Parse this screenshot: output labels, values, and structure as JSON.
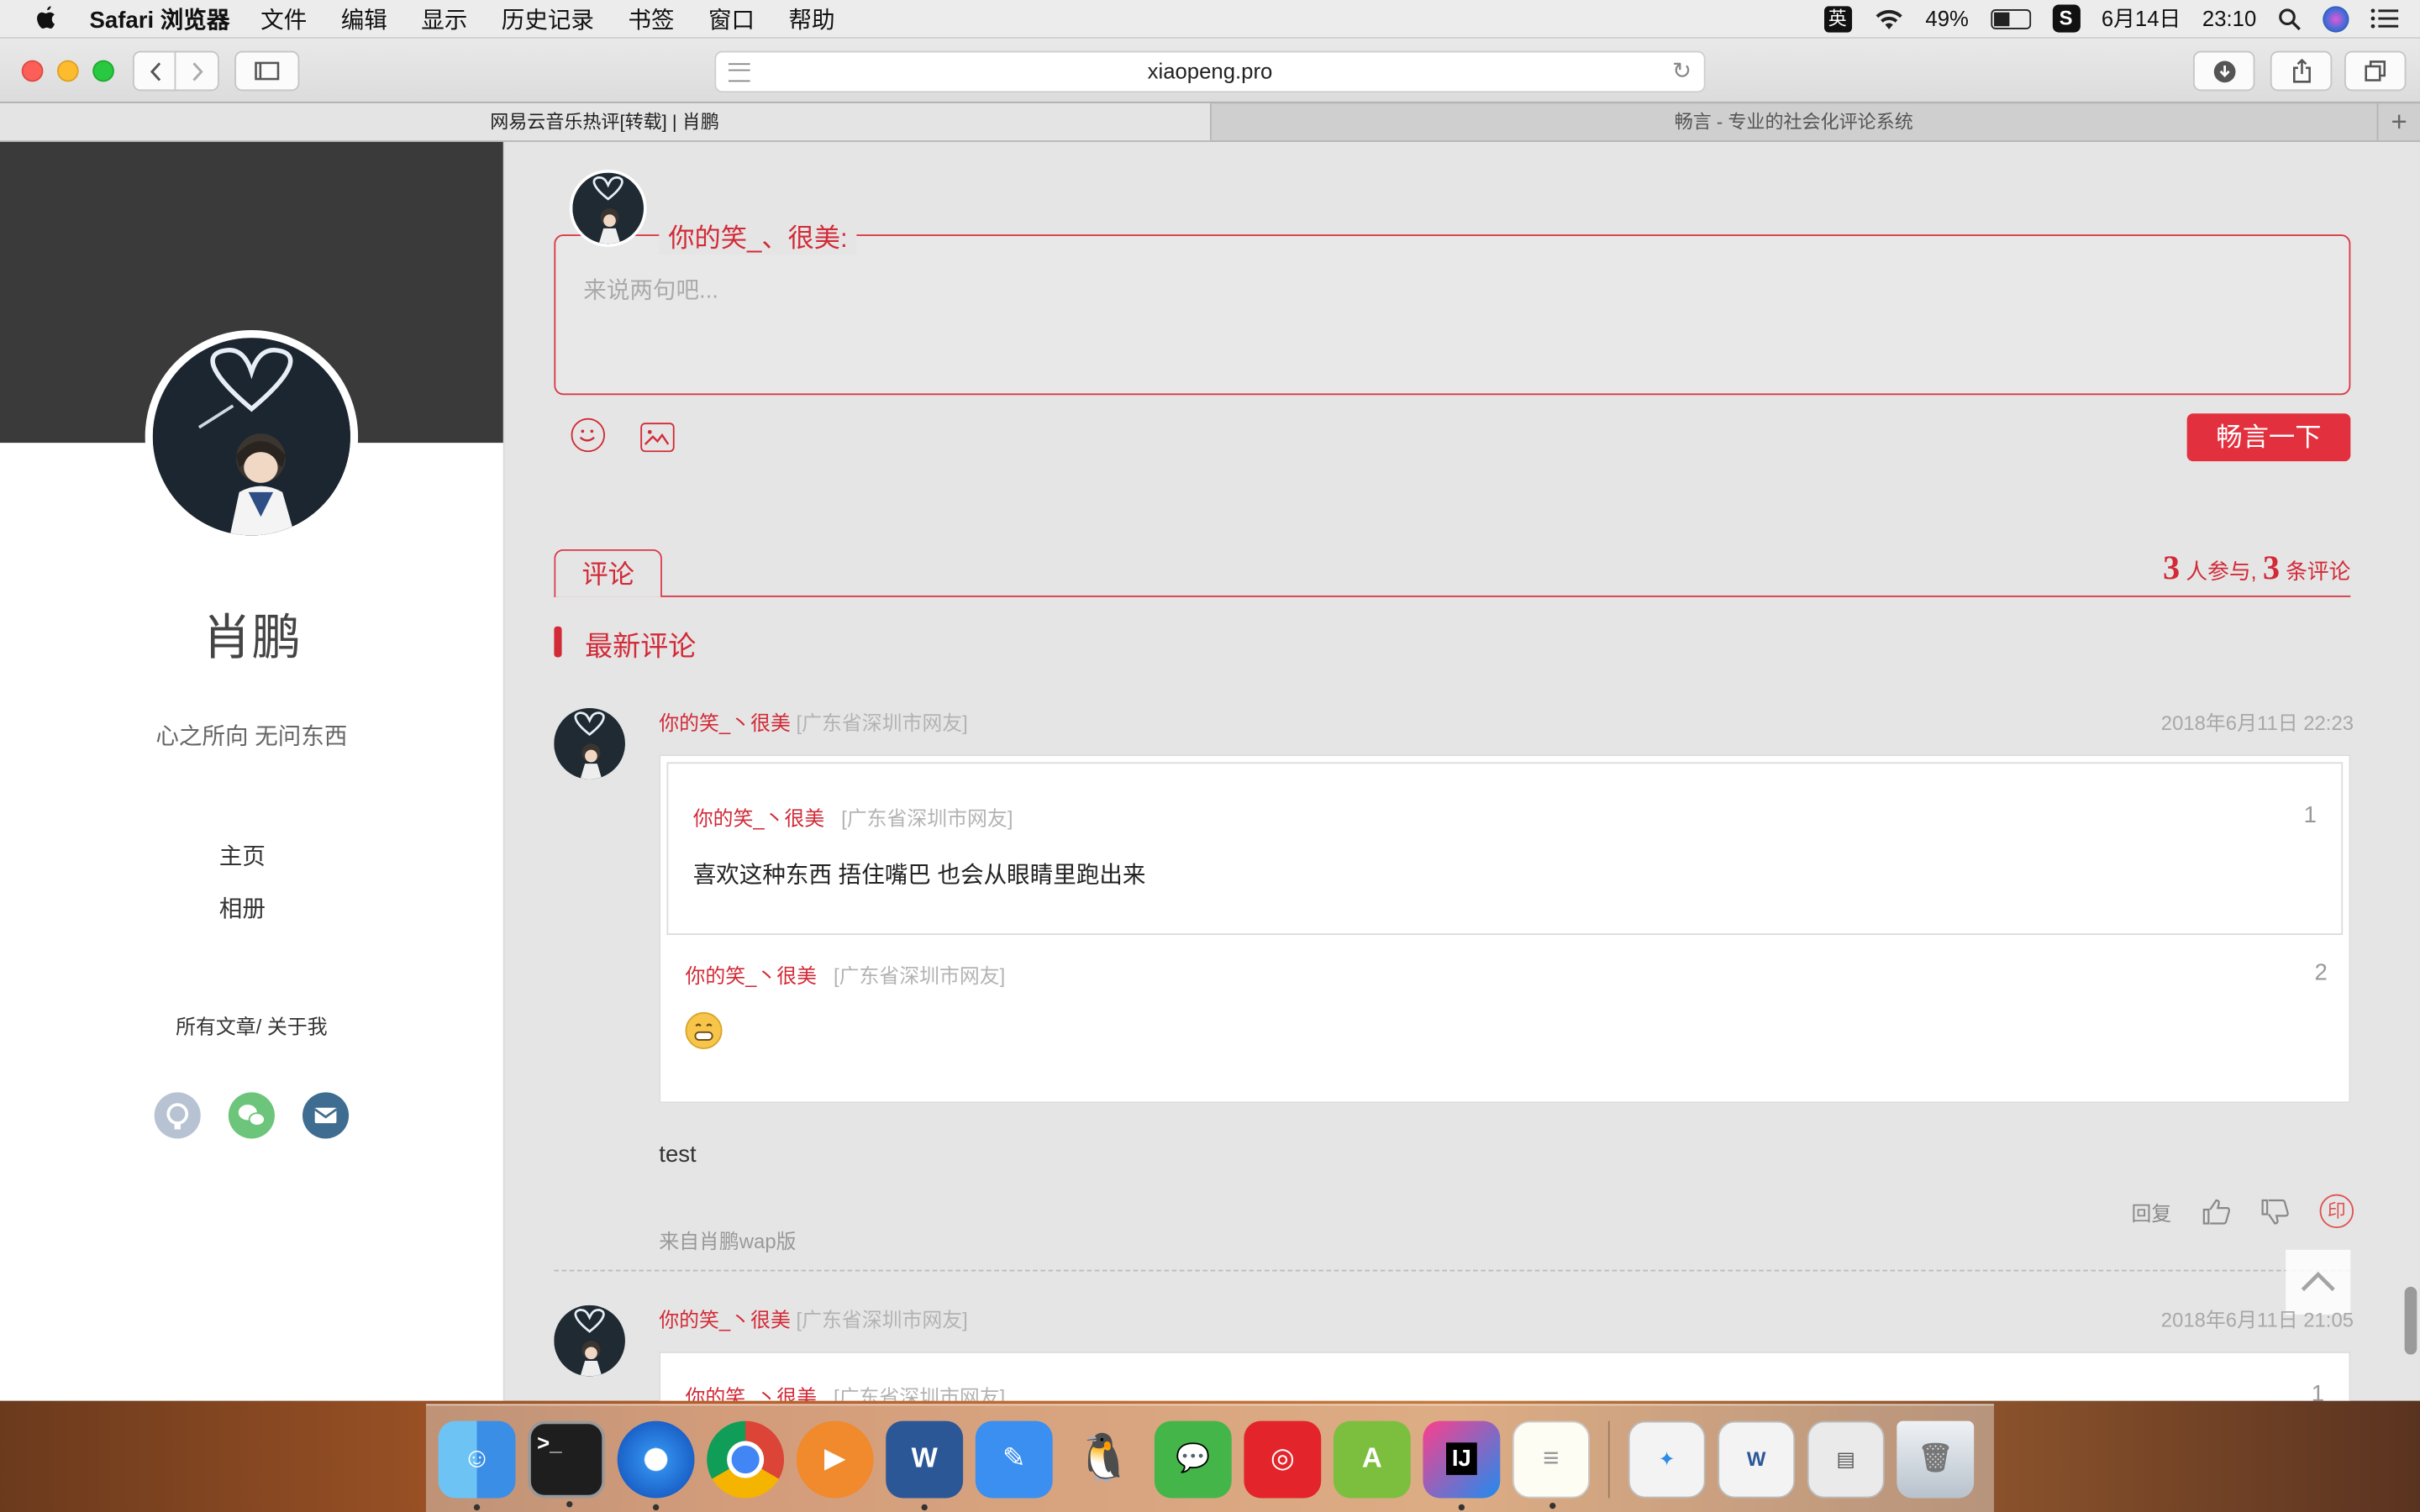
{
  "menubar": {
    "app_name": "Safari 浏览器",
    "items": [
      "文件",
      "编辑",
      "显示",
      "历史记录",
      "书签",
      "窗口",
      "帮助"
    ],
    "ime": "英",
    "battery": "49%",
    "battery_level": 0.49,
    "date": "6月14日",
    "time": "23:10"
  },
  "toolbar": {
    "url": "xiaopeng.pro"
  },
  "tabs": [
    {
      "title": "网易云音乐热评[转载] | 肖鹏"
    },
    {
      "title": "畅言 - 专业的社会化评论系统"
    }
  ],
  "sidebar": {
    "name": "肖鹏",
    "motto": "心之所向 无问东西",
    "nav": [
      "主页",
      "相册"
    ],
    "links": "所有文章/ 关于我",
    "social": [
      "github-icon",
      "wechat-icon",
      "mail-icon"
    ]
  },
  "editor": {
    "current_user": "你的笑_、很美:",
    "placeholder": "来说两句吧...",
    "submit_label": "畅言一下"
  },
  "comments_section": {
    "tab_label": "评论",
    "participants": "3",
    "participants_suffix": " 人参与,",
    "count": "3",
    "count_suffix": " 条评论",
    "latest_label": "最新评论"
  },
  "comments": [
    {
      "user": "你的笑_丶很美",
      "location": "[广东省深圳市网友]",
      "time": "2018年6月11日 22:23",
      "quotes": [
        {
          "user": "你的笑_丶很美",
          "location": "[广东省深圳市网友]",
          "num": "1",
          "text": "喜欢这种东西 捂住嘴巴 也会从眼睛里跑出来"
        },
        {
          "user": "你的笑_丶很美",
          "location": "[广东省深圳市网友]",
          "num": "2",
          "emoji": "grin-emoji"
        }
      ],
      "body": "test",
      "reply_label": "回复",
      "yin": "印",
      "from": "来自肖鹏wap版"
    },
    {
      "user": "你的笑_丶很美",
      "location": "[广东省深圳市网友]",
      "time": "2018年6月11日 21:05",
      "quotes": [
        {
          "user": "你的笑_丶很美",
          "location": "[广东省深圳市网友]",
          "num": "1"
        }
      ]
    }
  ],
  "dock": [
    "finder-icon",
    "terminal-icon",
    "safari-icon",
    "chrome-icon",
    "music-player-icon",
    "word-icon",
    "notes-pen-icon",
    "qq-icon",
    "wechat-icon",
    "netease-music-icon",
    "android-studio-icon",
    "intellij-icon",
    "textedit-icon",
    "recent-safari-icon",
    "recent-word-icon",
    "recent-preview-icon",
    "trash-icon"
  ]
}
